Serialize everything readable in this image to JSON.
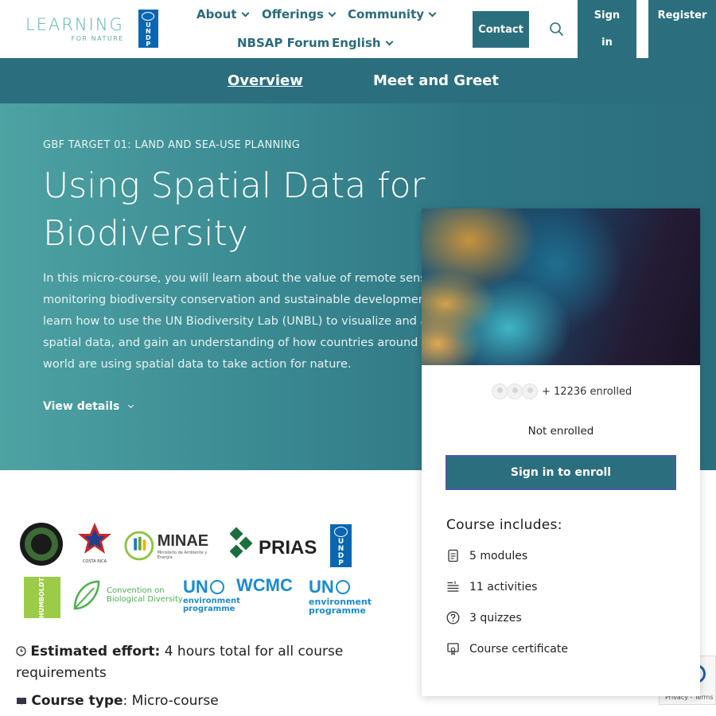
{
  "header": {
    "logo_main": "LEARNING",
    "logo_sub": "FOR NATURE",
    "undp_letters": [
      "U",
      "N",
      "D",
      "P"
    ],
    "nav": {
      "about": "About",
      "offerings": "Offerings",
      "community": "Community",
      "nbsap": "NBSAP Forum",
      "language": "English"
    },
    "contact": "Contact",
    "signin_line1": "Sign",
    "signin_line2": "in",
    "register": "Register"
  },
  "subnav": {
    "tabs": [
      {
        "label": "Overview",
        "active": true
      },
      {
        "label": "Meet and Greet",
        "active": false
      }
    ]
  },
  "hero": {
    "kicker": "GBF TARGET 01: LAND AND SEA-USE PLANNING",
    "title_line1": "Using Spatial Data for",
    "title_line2": "Biodiversity",
    "desc_lines": [
      "In this micro-course, you will learn about the value of remote sensing",
      "monitoring biodiversity conservation and sustainable development,",
      "learn how to use the UN Biodiversity Lab (UNBL) to visualize and ana",
      "spatial data, and gain an understanding of how countries around the",
      "world are using spatial data to take action for nature."
    ],
    "view_details": "View details"
  },
  "card": {
    "enrolled": "+ 12236 enrolled",
    "status": "Not enrolled",
    "enroll_button": "Sign in to enroll",
    "includes_title": "Course includes:",
    "includes": [
      {
        "icon": "document-icon",
        "label": "5 modules"
      },
      {
        "icon": "list-icon",
        "label": "11 activities"
      },
      {
        "icon": "question-icon",
        "label": "3 quizzes"
      },
      {
        "icon": "certificate-icon",
        "label": "Course certificate"
      }
    ]
  },
  "partners": {
    "minae": "MINAE",
    "minae_sub": "Ministerio de Ambiente y Energía",
    "prias": "PRIAS",
    "humboldt": "HUMBOLDT",
    "cbd_line1": "Convention on",
    "cbd_line2": "Biological Diversity",
    "unep_un": "UN",
    "unep_line1": "environment",
    "unep_line2": "programme",
    "wcmc": "WCMC",
    "costa_rica": "COSTA RICA"
  },
  "info": {
    "effort_label": "Estimated effort:",
    "effort_value": " 4 hours total for all course",
    "effort_value2": "requirements",
    "type_label": "Course type",
    "type_value": ": Micro-course"
  },
  "recaptcha": {
    "terms": "Privacy - Terms"
  },
  "colors": {
    "primary": "#2b6f7f",
    "logo_teal": "#5bb3ad",
    "undp_blue": "#0a66b2",
    "unep_blue": "#1a8bd1",
    "cbd_green": "#4caf50"
  }
}
